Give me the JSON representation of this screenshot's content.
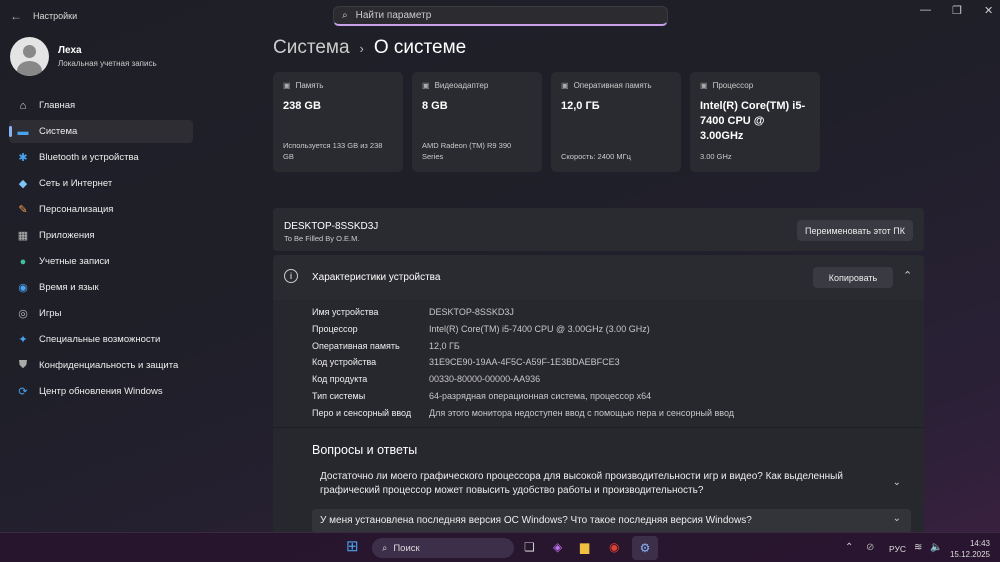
{
  "window": {
    "title": "Настройки",
    "search_placeholder": "Найти параметр"
  },
  "user": {
    "name": "Леха",
    "account": "Локальная учетная запись"
  },
  "nav": [
    {
      "label": "Главная",
      "icon": "home-icon",
      "glyph": "⌂",
      "color": "#ddd"
    },
    {
      "label": "Система",
      "icon": "system-icon",
      "glyph": "▬",
      "color": "#4aa3f0"
    },
    {
      "label": "Bluetooth и устройства",
      "icon": "bluetooth-icon",
      "glyph": "✱",
      "color": "#4aa3f0"
    },
    {
      "label": "Сеть и Интернет",
      "icon": "network-icon",
      "glyph": "◆",
      "color": "#7fc4f5"
    },
    {
      "label": "Персонализация",
      "icon": "brush-icon",
      "glyph": "✎",
      "color": "#f0a050"
    },
    {
      "label": "Приложения",
      "icon": "apps-icon",
      "glyph": "▦",
      "color": "#bbb"
    },
    {
      "label": "Учетные записи",
      "icon": "accounts-icon",
      "glyph": "●",
      "color": "#40c0a0"
    },
    {
      "label": "Время и язык",
      "icon": "globe-icon",
      "glyph": "◉",
      "color": "#4aa3f0"
    },
    {
      "label": "Игры",
      "icon": "gamepad-icon",
      "glyph": "◎",
      "color": "#bbb"
    },
    {
      "label": "Специальные возможности",
      "icon": "accessibility-icon",
      "glyph": "✦",
      "color": "#4aa3f0"
    },
    {
      "label": "Конфиденциальность и защита",
      "icon": "shield-icon",
      "glyph": "⛊",
      "color": "#aaa"
    },
    {
      "label": "Центр обновления Windows",
      "icon": "update-icon",
      "glyph": "⟳",
      "color": "#4aa3f0"
    }
  ],
  "header": {
    "crumb": "Система",
    "title": "О системе"
  },
  "cards": [
    {
      "label": "Память",
      "value": "238 GB",
      "sub": "Используется 133 GB из 238 GB"
    },
    {
      "label": "Видеоадаптер",
      "value": "8 GB",
      "sub": "AMD Radeon (TM) R9 390 Series"
    },
    {
      "label": "Оперативная память",
      "value": "12,0 ГБ",
      "sub": "Скорость: 2400 МГц"
    },
    {
      "label": "Процессор",
      "value": "Intel(R) Core(TM) i5-7400 CPU @ 3.00GHz",
      "sub": "3.00 GHz"
    }
  ],
  "pc": {
    "name": "DESKTOP-8SSKD3J",
    "model": "To Be Filled By O.E.M.",
    "rename": "Переименовать этот ПК"
  },
  "specs": {
    "title": "Характеристики устройства",
    "copy": "Копировать",
    "rows": [
      {
        "k": "Имя устройства",
        "v": "DESKTOP-8SSKD3J"
      },
      {
        "k": "Процессор",
        "v": "Intel(R) Core(TM) i5-7400 CPU @ 3.00GHz (3.00 GHz)"
      },
      {
        "k": "Оперативная память",
        "v": "12,0 ГБ"
      },
      {
        "k": "Код устройства",
        "v": "31E9CE90-19AA-4F5C-A59F-1E3BDAEBFCE3"
      },
      {
        "k": "Код продукта",
        "v": "00330-80000-00000-AA936"
      },
      {
        "k": "Тип системы",
        "v": "64-разрядная операционная система, процессор x64"
      },
      {
        "k": "Перо и сенсорный ввод",
        "v": "Для этого монитора недоступен ввод с помощью пера и сенсорный ввод"
      }
    ]
  },
  "faq": {
    "title": "Вопросы и ответы",
    "items": [
      "Достаточно ли моего графического процессора для высокой производительности игр и видео? Как выделенный графический процессор может повысить удобство работы и производительность?",
      "У меня установлена последняя версия ОС Windows? Что такое последняя версия Windows?"
    ]
  },
  "taskbar": {
    "search": "Поиск",
    "lang": "РУС",
    "time": "14:43",
    "date": "15.12.2025"
  }
}
